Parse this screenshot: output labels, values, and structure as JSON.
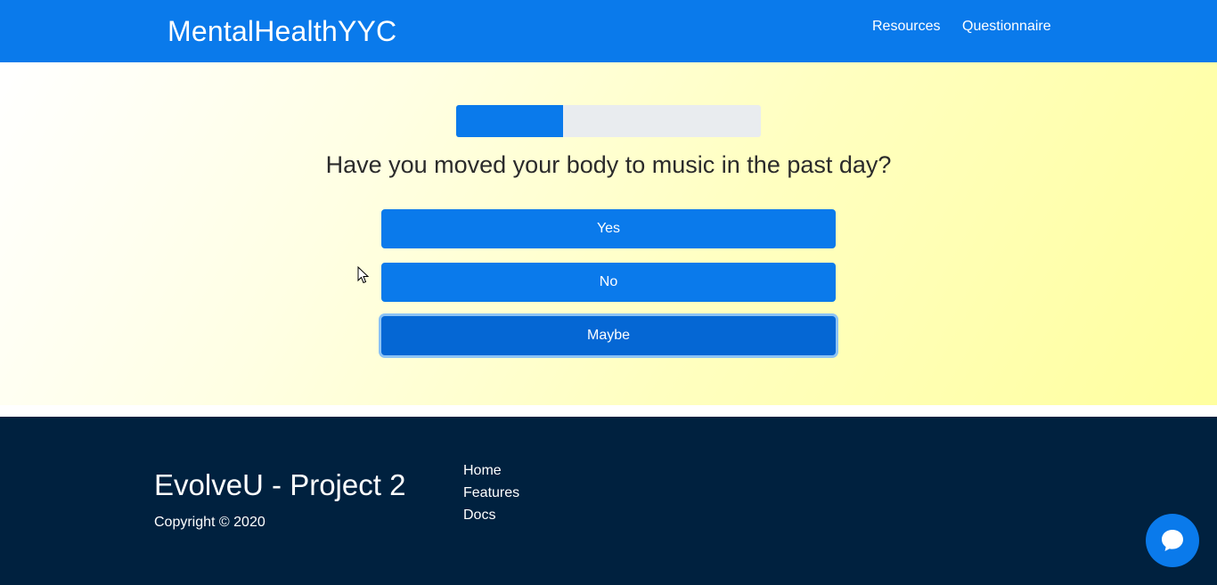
{
  "header": {
    "brand": "MentalHealthYYC",
    "nav": [
      {
        "label": "Resources"
      },
      {
        "label": "Questionnaire"
      }
    ]
  },
  "questionnaire": {
    "progress_fraction": 0.35,
    "question": "Have you moved your body to music in the past day?",
    "answers": [
      {
        "label": "Yes"
      },
      {
        "label": "No"
      },
      {
        "label": "Maybe"
      }
    ],
    "focused_answer": "Maybe"
  },
  "footer": {
    "title": "EvolveU - Project 2",
    "copyright": "Copyright © 2020",
    "links": [
      {
        "label": "Home"
      },
      {
        "label": "Features"
      },
      {
        "label": "Docs"
      }
    ]
  },
  "colors": {
    "primary": "#0a7aeb",
    "footer_bg": "#00213f",
    "progress_track": "#e9ecef"
  },
  "icons": {
    "chat": "chat-bubble-icon",
    "cursor": "mouse-pointer-icon"
  }
}
